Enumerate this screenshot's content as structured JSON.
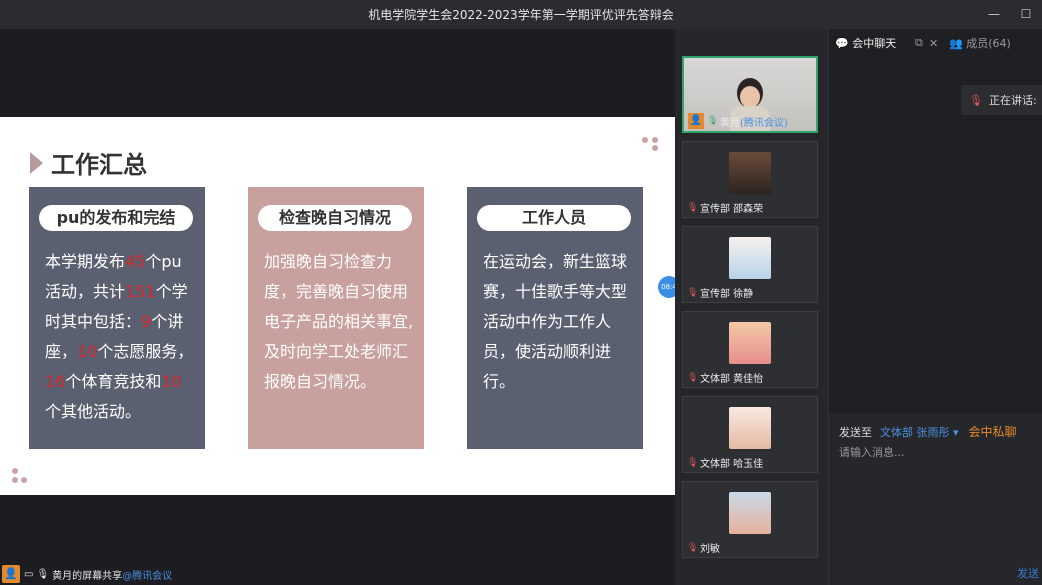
{
  "window": {
    "title": "机电学院学生会2022-2023学年第一学期评优评先答辩会",
    "min_icon": "minimize-icon",
    "max_icon": "maximize-icon"
  },
  "slide": {
    "title": "工作汇总",
    "cards": [
      {
        "header": "pu的发布和完结",
        "color": "#5a6070",
        "body": [
          "本学期发布",
          "45",
          "个pu活动，共计",
          "151",
          "个学时其中包括：",
          "9",
          "个讲座，",
          "10",
          "个志愿服务，",
          "16",
          "个体育竞技和",
          "10",
          "个其他活动。"
        ]
      },
      {
        "header": "检查晚自习情况",
        "color": "#c8a09d",
        "body_text": "加强晚自习检查力度，完善晚自习使用电子产品的相关事宜,及时向学工处老师汇报晚自习情况。"
      },
      {
        "header": "工作人员",
        "color": "#5a6070",
        "body_text": "在运动会，新生篮球赛，十佳歌手等大型活动中作为工作人员，使活动顺利进行。"
      }
    ]
  },
  "side_handle": {
    "text": "08:4"
  },
  "bottombar": {
    "share_text": "黄月的屏幕共享",
    "brand": "@腾讯会议"
  },
  "participants": [
    {
      "name": "黄月",
      "suffix": "(腾讯会议)",
      "active": true,
      "has_video": true
    },
    {
      "name": "宣传部 邵森荣",
      "active": false
    },
    {
      "name": "宣传部 徐静",
      "active": false
    },
    {
      "name": "文体部 黄佳怡",
      "active": false
    },
    {
      "name": "文体部 哈玉佳",
      "active": false
    },
    {
      "name": "刘敏",
      "active": false
    }
  ],
  "chat": {
    "tab_chat": "会中聊天",
    "tab_members": "成员(64)",
    "speaking": "正在讲话:",
    "send_to_label": "发送至",
    "send_to_value": "文体部 张雨彤",
    "private_label": "会中私聊",
    "input_placeholder": "请输入消息...",
    "send_button": "发送"
  }
}
